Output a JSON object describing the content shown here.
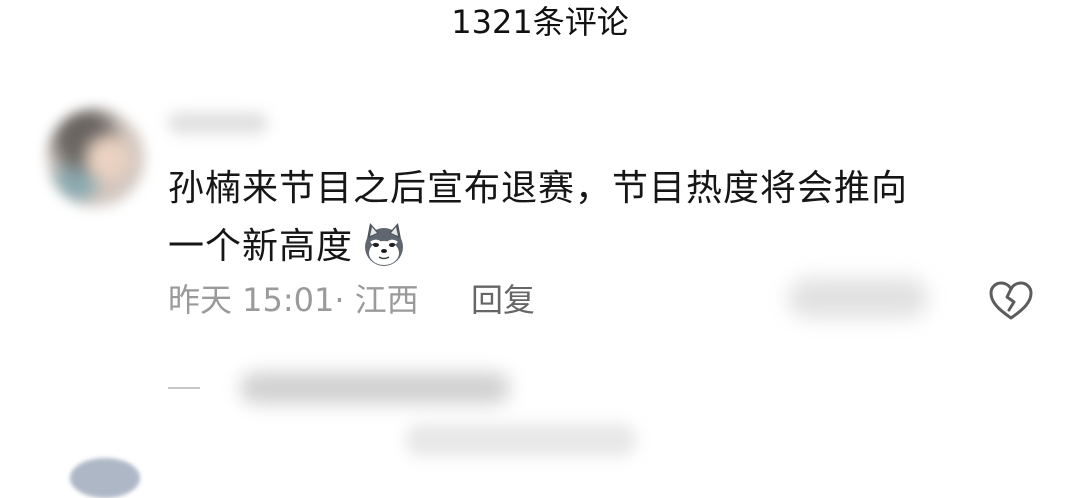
{
  "header": {
    "title": "1321条评论"
  },
  "comment": {
    "text_line1": "孙楠来节目之后宣布退赛，节目热度将会推向",
    "text_line2": "一个新高度",
    "emoji": "husky-emoji",
    "meta": "昨天 15:01· 江西",
    "reply_label": "回复",
    "dislike_icon": "broken-heart-icon",
    "colors": {
      "meta_text": "#9a9a9a",
      "reply_text": "#666666",
      "body_text": "#161616"
    }
  }
}
